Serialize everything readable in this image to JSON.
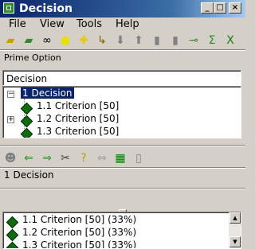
{
  "window": {
    "title": "Decision"
  },
  "menu": [
    "File",
    "View",
    "Tools",
    "Help"
  ],
  "toolbar_top": [
    {
      "name": "open-folder-icon",
      "glyph": "▰",
      "color": "#c8a000"
    },
    {
      "name": "folder-icon",
      "glyph": "▰",
      "color": "#2e8b2e"
    },
    {
      "name": "binoculars-icon",
      "glyph": "∞",
      "color": "#000"
    },
    {
      "name": "lightbulb-icon",
      "glyph": "●",
      "color": "#e8e000"
    },
    {
      "name": "add-icon",
      "glyph": "✚",
      "color": "#e8c800"
    },
    {
      "name": "link-icon",
      "glyph": "↳",
      "color": "#806000"
    },
    {
      "name": "arrow-down-icon",
      "glyph": "⬇",
      "color": "#808080"
    },
    {
      "name": "arrow-up-icon",
      "glyph": "⬆",
      "color": "#808080"
    },
    {
      "name": "copy-icon",
      "glyph": "▮",
      "color": "#808080"
    },
    {
      "name": "paste-icon",
      "glyph": "▮",
      "color": "#808080"
    },
    {
      "name": "key-icon",
      "glyph": "⊸",
      "color": "#2e8b2e"
    },
    {
      "name": "sigma-icon",
      "glyph": "Σ",
      "color": "#2e8b2e"
    },
    {
      "name": "excel-icon",
      "glyph": "X",
      "color": "#1a7a1a"
    }
  ],
  "prime_option": {
    "label": "Prime Option",
    "value": "Decision"
  },
  "tree": {
    "root": "1 Decision",
    "children": [
      "1.1 Criterion [50]",
      "1.2 Criterion [50]",
      "1.3 Criterion [50]"
    ]
  },
  "toolbar_mid": [
    {
      "name": "user-icon",
      "glyph": "☻",
      "color": "#808080"
    },
    {
      "name": "arrow-left-icon",
      "glyph": "⇐",
      "color": "#2e8b2e"
    },
    {
      "name": "arrow-right-icon",
      "glyph": "⇒",
      "color": "#2e8b2e"
    },
    {
      "name": "scissors-icon",
      "glyph": "✂",
      "color": "#404040"
    },
    {
      "name": "help-icon",
      "glyph": "?",
      "color": "#b8a000"
    },
    {
      "name": "swap-icon",
      "glyph": "⇔",
      "color": "#a0a0a0"
    },
    {
      "name": "grid-icon",
      "glyph": "▦",
      "color": "#008000"
    },
    {
      "name": "document-icon",
      "glyph": "▯",
      "color": "#808080"
    }
  ],
  "current_node": "1 Decision",
  "slider": {
    "value_fraction": 0.5
  },
  "results": [
    "1.1 Criterion [50] (33%)",
    "1.2 Criterion [50] (33%)",
    "1.3 Criterion [50] (33%)"
  ]
}
